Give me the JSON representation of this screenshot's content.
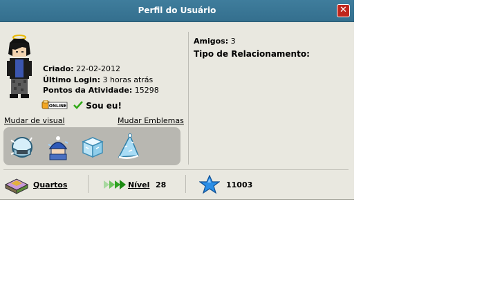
{
  "window": {
    "title": "Perfil do Usuário",
    "close_label": "✕"
  },
  "profile": {
    "criado_label": "Criado:",
    "criado_value": "22-02-2012",
    "ultimo_login_label": "Último Login:",
    "ultimo_login_value": "3 horas atrás",
    "pontos_label": "Pontos da Atividade:",
    "pontos_value": "15298",
    "online_badge": "ONLINE",
    "sou_eu": "Sou eu!"
  },
  "links": {
    "mudar_visual": "Mudar de visual",
    "mudar_emblemas": "Mudar Emblemas"
  },
  "badges": [
    {
      "icon": "ice-helmet-badge-icon"
    },
    {
      "icon": "frozen-figure-badge-icon"
    },
    {
      "icon": "ice-cube-badge-icon"
    },
    {
      "icon": "ice-party-hat-badge-icon"
    }
  ],
  "right": {
    "amigos_label": "Amigos:",
    "amigos_value": "3",
    "relacionamento_label": "Tipo de Relacionamento:"
  },
  "bottom": {
    "quartos_label": "Quartos",
    "nivel_label": "Nível",
    "nivel_value": "28",
    "stars_value": "11003"
  },
  "colors": {
    "titlebar": "#3f7d9c",
    "window_bg": "#e9e8e0",
    "close_red": "#c0261c",
    "check_green": "#2ea814",
    "star_blue": "#2a8ee6"
  }
}
